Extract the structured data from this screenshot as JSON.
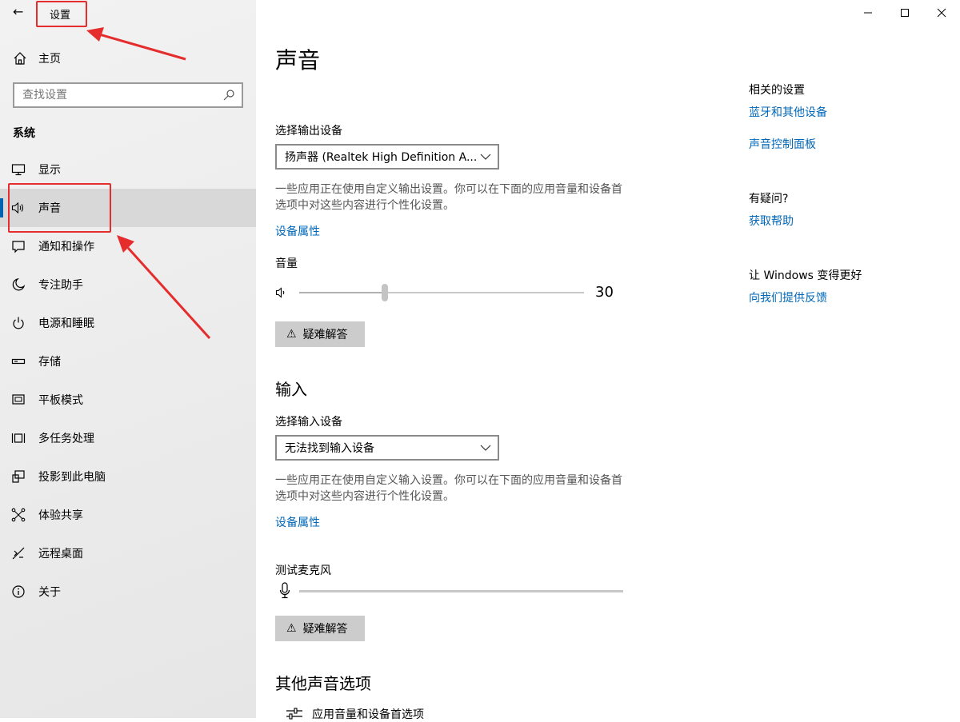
{
  "window": {
    "title": "设置",
    "back_icon": "back-arrow-icon",
    "controls": [
      "minimize-icon",
      "maximize-icon",
      "close-icon"
    ]
  },
  "sidebar": {
    "home_label": "主页",
    "search_placeholder": "查找设置",
    "section": "系统",
    "items": [
      {
        "label": "显示",
        "icon": "display-icon"
      },
      {
        "label": "声音",
        "icon": "speaker-icon",
        "active": true
      },
      {
        "label": "通知和操作",
        "icon": "notification-icon"
      },
      {
        "label": "专注助手",
        "icon": "moon-icon"
      },
      {
        "label": "电源和睡眠",
        "icon": "power-icon"
      },
      {
        "label": "存储",
        "icon": "storage-icon"
      },
      {
        "label": "平板模式",
        "icon": "tablet-icon"
      },
      {
        "label": "多任务处理",
        "icon": "multitask-icon"
      },
      {
        "label": "投影到此电脑",
        "icon": "project-icon"
      },
      {
        "label": "体验共享",
        "icon": "share-icon"
      },
      {
        "label": "远程桌面",
        "icon": "remote-icon"
      },
      {
        "label": "关于",
        "icon": "info-icon"
      }
    ]
  },
  "main": {
    "title": "声音",
    "output": {
      "label": "选择输出设备",
      "device": "扬声器 (Realtek High Definition A...",
      "desc": "一些应用正在使用自定义输出设置。你可以在下面的应用音量和设备首选项中对这些内容进行个性化设置。",
      "link": "设备属性"
    },
    "volume": {
      "label": "音量",
      "value": "30",
      "level": 0.3
    },
    "troubleshoot": "疑难解答",
    "input": {
      "heading": "输入",
      "label": "选择输入设备",
      "device": "无法找到输入设备",
      "desc": "一些应用正在使用自定义输入设置。你可以在下面的应用音量和设备首选项中对这些内容进行个性化设置。",
      "link": "设备属性"
    },
    "mic": {
      "label": "测试麦克风"
    },
    "other": {
      "heading": "其他声音选项",
      "item": "应用音量和设备首选项"
    }
  },
  "related": {
    "heading": "相关的设置",
    "links": [
      "蓝牙和其他设备",
      "声音控制面板"
    ],
    "question": "有疑问?",
    "help": "获取帮助",
    "improve": "让 Windows 变得更好",
    "feedback": "向我们提供反馈"
  },
  "annotation_color": "#e52d2d"
}
